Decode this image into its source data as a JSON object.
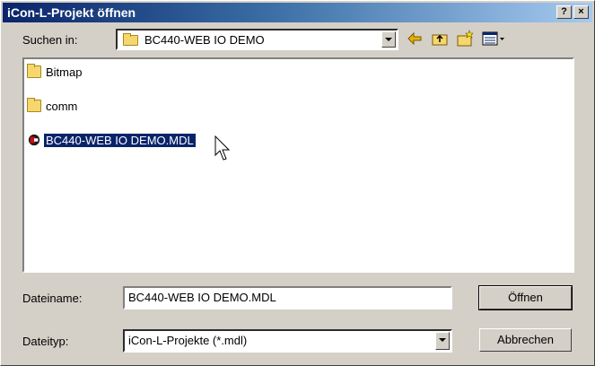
{
  "window": {
    "title": "iCon-L-Projekt öffnen",
    "help_label": "?",
    "close_label": "×"
  },
  "lookin": {
    "label": "Suchen in:",
    "value": "BC440-WEB IO DEMO"
  },
  "toolbar": {
    "icons": [
      "back-icon",
      "up-folder-icon",
      "new-folder-icon",
      "view-menu-icon"
    ]
  },
  "files": [
    {
      "name": "Bitmap",
      "type": "folder"
    },
    {
      "name": "comm",
      "type": "folder"
    },
    {
      "name": "BC440-WEB IO DEMO.MDL",
      "type": "project",
      "selected": true
    }
  ],
  "filename": {
    "label": "Dateiname:",
    "value": "BC440-WEB IO DEMO.MDL"
  },
  "filetype": {
    "label": "Dateityp:",
    "value": "iCon-L-Projekte (*.mdl)"
  },
  "buttons": {
    "open": "Öffnen",
    "cancel": "Abbrechen"
  },
  "colors": {
    "title_start": "#0a246a",
    "selection": "#0a246a",
    "face": "#d4d0c8"
  }
}
